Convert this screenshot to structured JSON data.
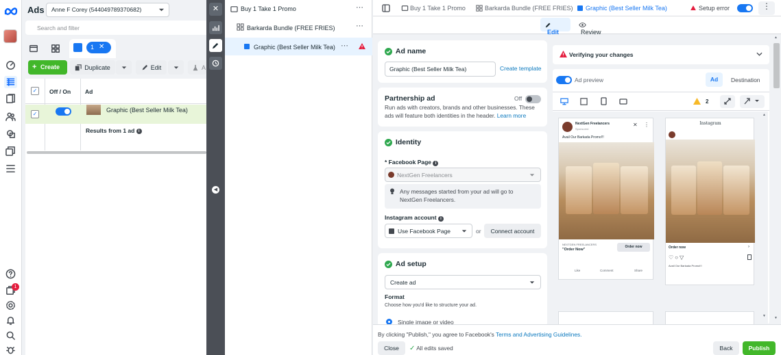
{
  "app": {
    "title": "Ads",
    "account": "Anne F Corey (544049789370682)",
    "search_placeholder": "Search and filter"
  },
  "toolbar": {
    "selected_count": "1",
    "create": "Create",
    "duplicate": "Duplicate",
    "edit": "Edit",
    "more": "A"
  },
  "table": {
    "col_toggle": "Off / On",
    "col_ad": "Ad",
    "row_name": "Graphic (Best Seller Milk Tea)",
    "results": "Results from 1 ad"
  },
  "left_nav": {
    "notification_count": "1"
  },
  "tree": {
    "campaign": "Buy 1 Take 1 Promo",
    "adset": "Barkarda Bundle (FREE FRIES)",
    "ad": "Graphic (Best Seller Milk Tea)"
  },
  "breadcrumb": {
    "campaign": "Buy 1 Take 1 Promo",
    "adset": "Barkarda Bundle (FREE FRIES)",
    "ad": "Graphic (Best Seller Milk Tea)",
    "status": "Setup error"
  },
  "modes": {
    "edit": "Edit",
    "review": "Review"
  },
  "ad_name": {
    "title": "Ad name",
    "value": "Graphic (Best Seller Milk Tea)",
    "create_template": "Create template"
  },
  "partnership": {
    "title": "Partnership ad",
    "state": "Off",
    "desc": "Run ads with creators, brands and other businesses. These ads will feature both identities in the header.",
    "learn_more": "Learn more"
  },
  "identity": {
    "title": "Identity",
    "fb_label": "* Facebook Page",
    "fb_value": "NextGen Freelancers",
    "info": "Any messages started from your ad will go to NextGen Freelancers.",
    "ig_label": "Instagram account",
    "ig_value": "Use Facebook Page",
    "or": "or",
    "connect": "Connect account"
  },
  "ad_setup": {
    "title": "Ad setup",
    "select": "Create ad",
    "format_title": "Format",
    "format_desc": "Choose how you'd like to structure your ad.",
    "option": "Single image or video"
  },
  "verify": {
    "text": "Verifying your changes"
  },
  "preview": {
    "label": "Ad preview",
    "tab_ad": "Ad",
    "tab_dest": "Destination",
    "warn_count": "2",
    "fb": {
      "page": "NextGen Freelancers",
      "sponsored": "Sponsored",
      "text": "Avail Our Barkada Promo!!!",
      "cta_brand": "NEXTGEN FREELANCERS",
      "cta_headline": "\"Order Now\"",
      "cta": "Order now",
      "like": "Like",
      "comment": "Comment",
      "share": "Share"
    },
    "ig": {
      "logo": "Instagram",
      "cta": "Order now",
      "caption": "Avail Our Barkada Promo!!!"
    }
  },
  "footer": {
    "terms_prefix": "By clicking \"Publish,\" you agree to Facebook's",
    "terms_link": "Terms and Advertising Guidelines.",
    "close": "Close",
    "saved": "All edits saved",
    "back": "Back",
    "publish": "Publish"
  },
  "colors": {
    "accent": "#1877f2",
    "green": "#42b72a",
    "error": "#e41e3f",
    "warn": "#f7b928"
  }
}
